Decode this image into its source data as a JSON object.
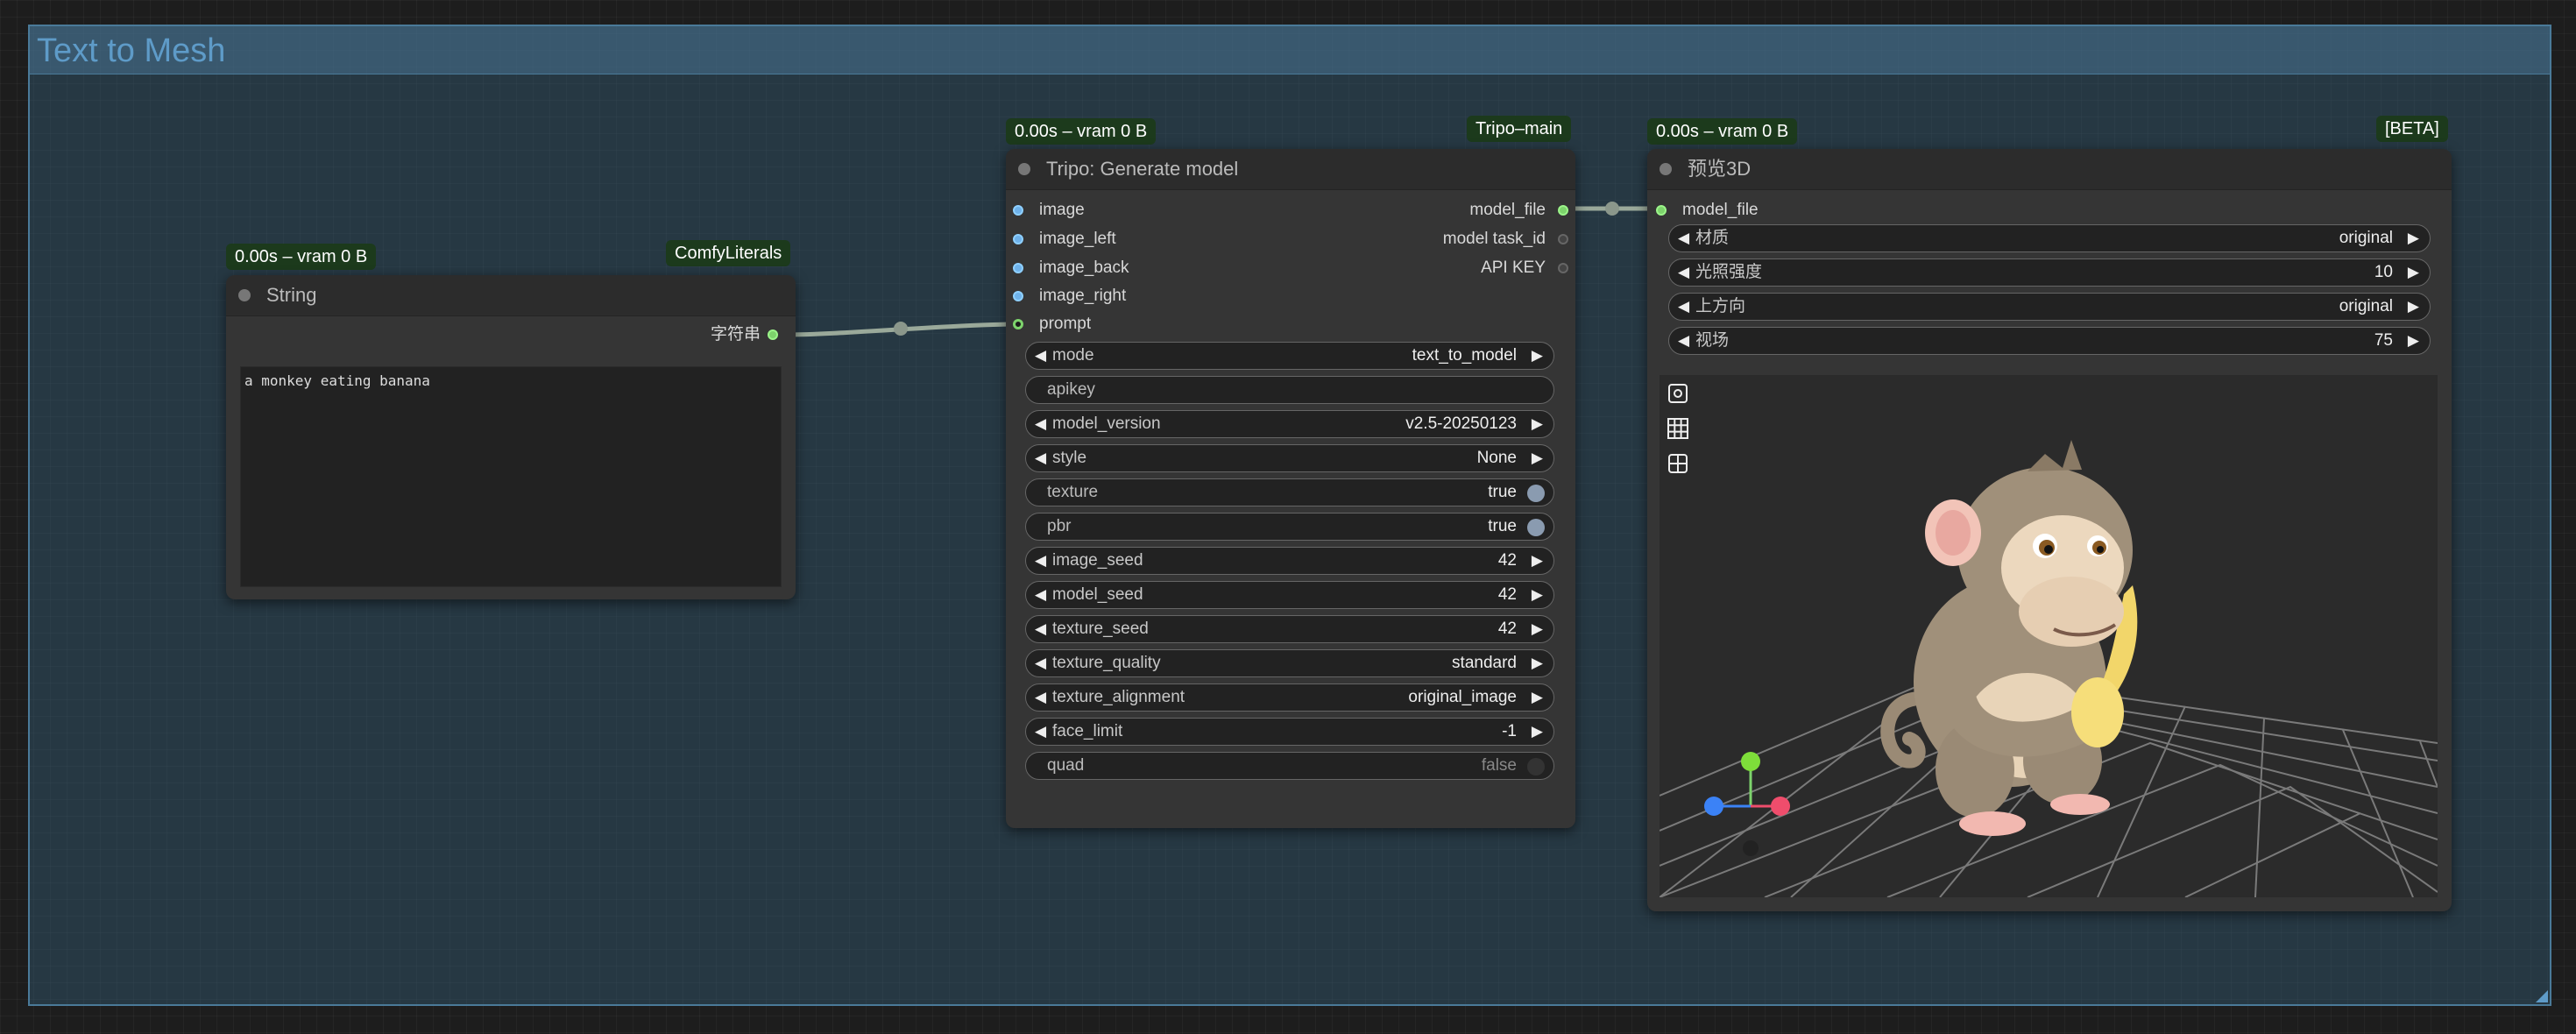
{
  "group": {
    "title": "Text to Mesh"
  },
  "string_node": {
    "badge_time": "0.00s – vram 0 B",
    "badge_pack": "ComfyLiterals",
    "title": "String",
    "output_label": "字符串",
    "text": "a monkey eating banana"
  },
  "tripo_node": {
    "badge_time": "0.00s – vram 0 B",
    "badge_pack": "Tripo–main",
    "title": "Tripo: Generate model",
    "inputs": [
      "image",
      "image_left",
      "image_back",
      "image_right",
      "prompt"
    ],
    "outputs": [
      "model_file",
      "model task_id",
      "API KEY"
    ],
    "widgets": {
      "mode": {
        "label": "mode",
        "value": "text_to_model"
      },
      "apikey": {
        "label": "apikey"
      },
      "model_version": {
        "label": "model_version",
        "value": "v2.5-20250123"
      },
      "style": {
        "label": "style",
        "value": "None"
      },
      "texture": {
        "label": "texture",
        "value": "true"
      },
      "pbr": {
        "label": "pbr",
        "value": "true"
      },
      "image_seed": {
        "label": "image_seed",
        "value": "42"
      },
      "model_seed": {
        "label": "model_seed",
        "value": "42"
      },
      "texture_seed": {
        "label": "texture_seed",
        "value": "42"
      },
      "texture_quality": {
        "label": "texture_quality",
        "value": "standard"
      },
      "texture_alignment": {
        "label": "texture_alignment",
        "value": "original_image"
      },
      "face_limit": {
        "label": "face_limit",
        "value": "-1"
      },
      "quad": {
        "label": "quad",
        "value": "false"
      }
    }
  },
  "preview_node": {
    "badge_time": "0.00s – vram 0 B",
    "badge_pack": "[BETA]",
    "title": "预览3D",
    "input_label": "model_file",
    "widgets": {
      "material": {
        "label": "材质",
        "value": "original"
      },
      "light": {
        "label": "光照强度",
        "value": "10"
      },
      "up": {
        "label": "上方向",
        "value": "original"
      },
      "fov": {
        "label": "视场",
        "value": "75"
      }
    }
  },
  "colors": {
    "link": "#9aa99a",
    "port_input": "#6fb2ea",
    "port_output": "#7dd36c",
    "group_title": "#5e9bc8",
    "badge_bg": "#1c3a1c"
  },
  "icons": [
    "camera-icon",
    "grid-icon",
    "layout-icon",
    "axis-gizmo"
  ]
}
